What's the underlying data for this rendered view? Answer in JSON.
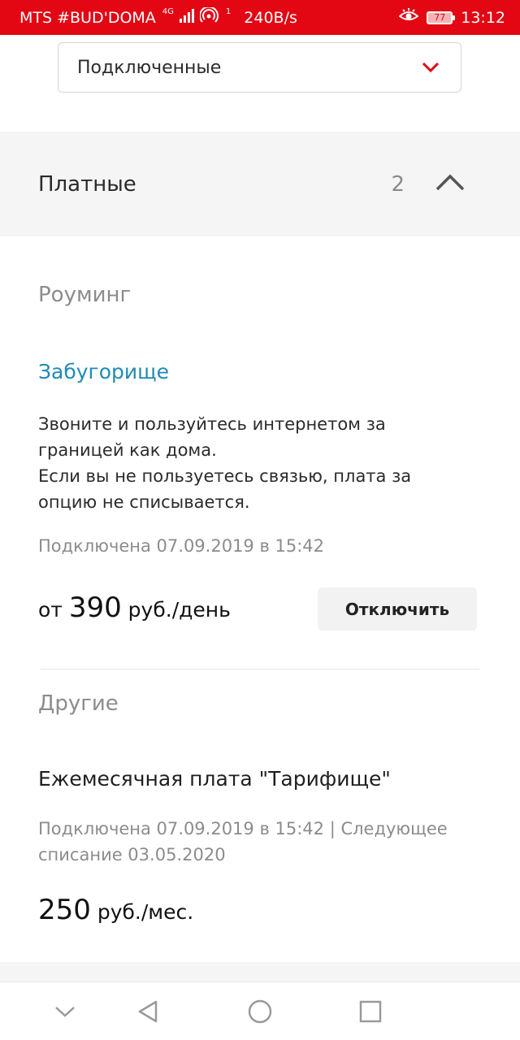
{
  "status_bar": {
    "carrier": "MTS #BUD'DOMA",
    "network_badge": "4G",
    "hotspot_badge": "1",
    "speed": "240B/s",
    "battery": "77",
    "time": "13:12"
  },
  "filter": {
    "selected": "Подключенные"
  },
  "section": {
    "title": "Платные",
    "count": "2"
  },
  "services": [
    {
      "category": "Роуминг",
      "name": "Забугорище",
      "description": [
        "Звоните и пользуйтесь интернетом за границей как дома.",
        "Если вы не пользуетесь связью, плата за опцию не списывается."
      ],
      "meta": "Подключена 07.09.2019 в 15:42",
      "price_prefix": "от ",
      "price_amount": "390",
      "price_unit": " руб./день",
      "button_label": "Отключить"
    },
    {
      "category": "Другие",
      "name": "Ежемесячная плата \"Тарифище\"",
      "meta": "Подключена 07.09.2019 в 15:42 | Следующее списание 03.05.2020",
      "price_amount": "250",
      "price_unit": " руб./мес."
    }
  ],
  "colors": {
    "brand_red": "#e30613",
    "link_blue": "#1f8bb5",
    "muted_gray": "#8c8c8c"
  }
}
